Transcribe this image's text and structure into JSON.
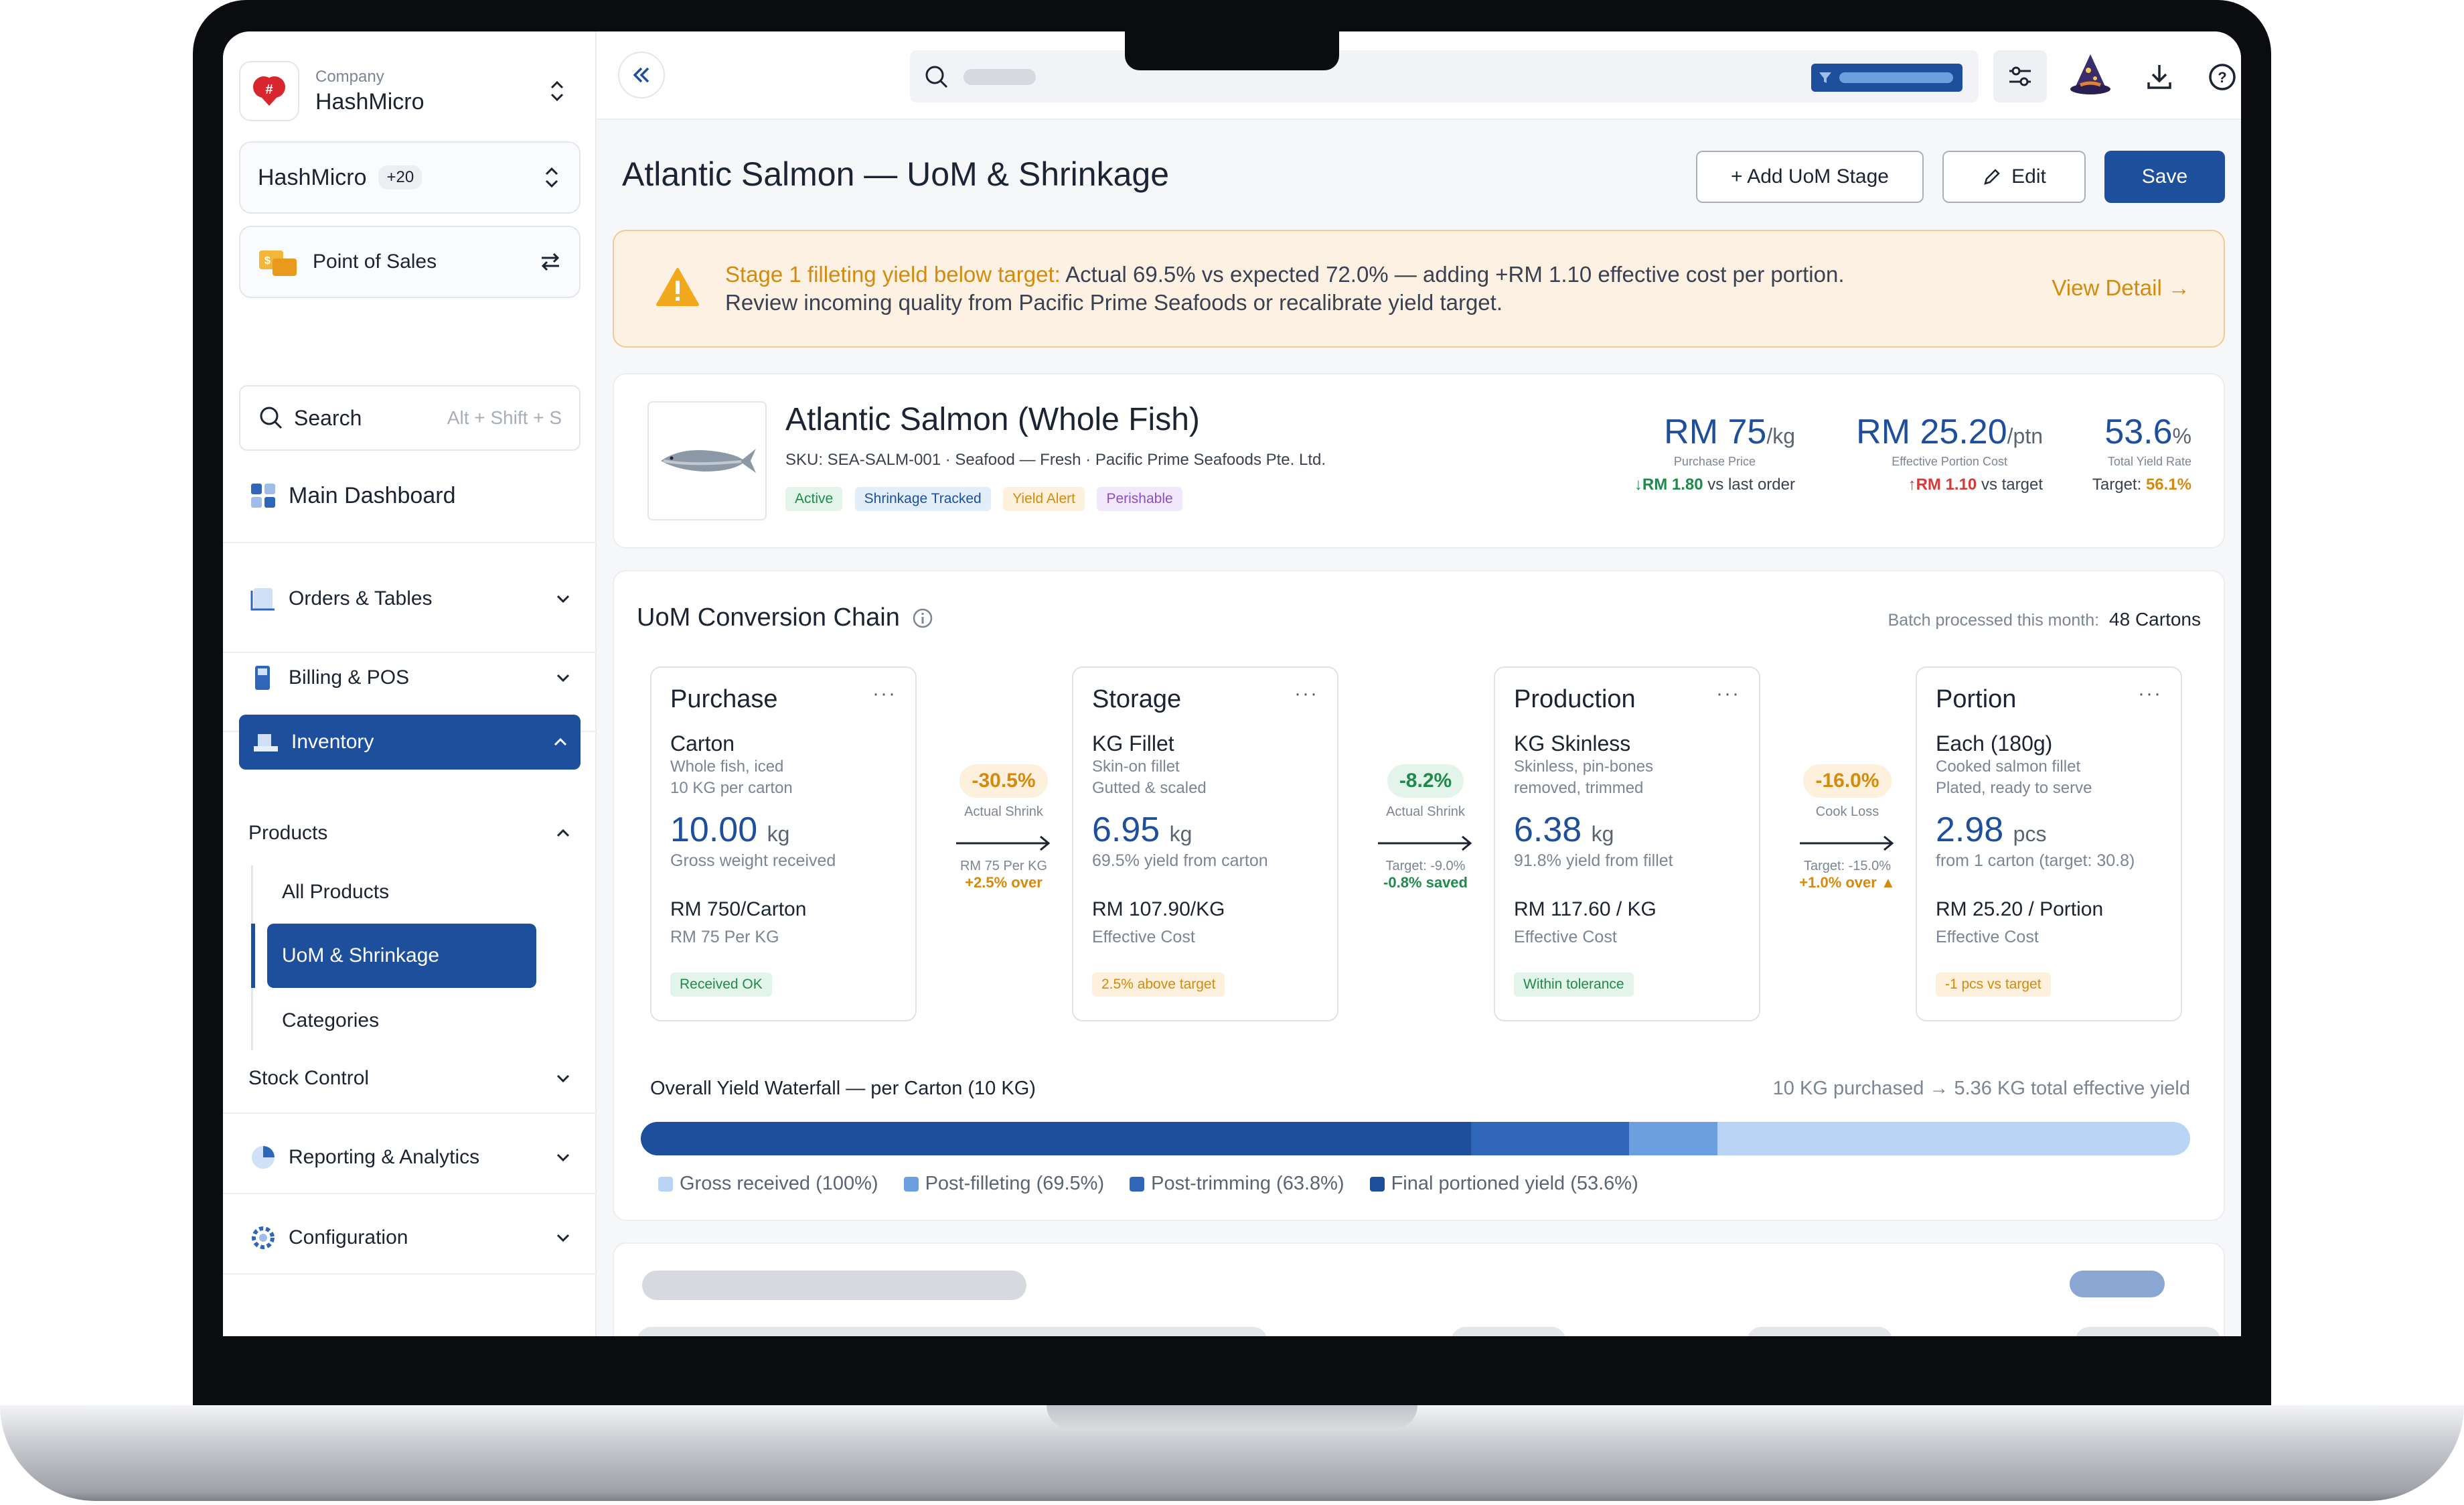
{
  "company": {
    "label": "Company",
    "name": "HashMicro"
  },
  "org": {
    "name": "HashMicro",
    "count": "+20"
  },
  "module": {
    "name": "Point of Sales"
  },
  "search": {
    "placeholder": "Search",
    "shortcut": "Alt + Shift + S"
  },
  "nav": {
    "main_dashboard": "Main Dashboard",
    "orders_tables": "Orders & Tables",
    "billing_pos": "Billing & POS",
    "inventory": "Inventory",
    "products": "Products",
    "all_products": "All Products",
    "uom_shrinkage": "UoM & Shrinkage",
    "categories": "Categories",
    "stock_control": "Stock Control",
    "reporting": "Reporting & Analytics",
    "configuration": "Configuration"
  },
  "page": {
    "title": "Atlantic Salmon — UoM & Shrinkage"
  },
  "actions": {
    "add_stage": "+ Add UoM Stage",
    "edit": "Edit",
    "save": "Save"
  },
  "alert": {
    "title": "Stage 1 filleting yield below target:",
    "line1": "Actual 69.5% vs expected 72.0% — adding +RM 1.10 effective cost per portion.",
    "line2": "Review incoming quality from Pacific Prime Seafoods or recalibrate yield target.",
    "link": "View Detail →"
  },
  "product": {
    "name": "Atlantic Salmon (Whole Fish)",
    "meta": "SKU: SEA-SALM-001 · Seafood — Fresh · Pacific Prime Seafoods Pte. Ltd.",
    "tags": [
      "Active",
      "Shrinkage Tracked",
      "Yield Alert",
      "Perishable"
    ],
    "kpi1": {
      "value": "RM 75",
      "unit": "/kg",
      "label": "Purchase Price",
      "delta": "↓RM 1.80",
      "delta_note": " vs last order"
    },
    "kpi2": {
      "value": "RM 25.20",
      "unit": "/ptn",
      "label": "Effective Portion Cost",
      "delta": "↑RM 1.10",
      "delta_note": " vs target"
    },
    "kpi3": {
      "value": "53.6",
      "unit": "%",
      "label": "Total Yield Rate",
      "target_label": "Target: ",
      "target": "56.1%"
    }
  },
  "chain": {
    "title": "UoM Conversion Chain",
    "batch_label": "Batch processed this month:",
    "batch_value": "48 Cartons",
    "stages": [
      {
        "title": "Purchase",
        "unit": "Carton",
        "desc1": "Whole fish, iced",
        "desc2": "10 KG per carton",
        "qty": "10.00",
        "qty_unit": "kg",
        "qty_note": "Gross weight received",
        "price": "RM 750/Carton",
        "price_note": "RM 75 Per KG",
        "badge": "Received OK"
      },
      {
        "title": "Storage",
        "unit": "KG Fillet",
        "desc1": "Skin-on fillet",
        "desc2": "Gutted & scaled",
        "qty": "6.95",
        "qty_unit": "kg",
        "qty_note": "69.5% yield from carton",
        "price": "RM 107.90/KG",
        "price_note": "Effective Cost",
        "badge": "2.5% above target"
      },
      {
        "title": "Production",
        "unit": "KG Skinless",
        "desc1": "Skinless, pin-bones",
        "desc2": "removed, trimmed",
        "qty": "6.38",
        "qty_unit": "kg",
        "qty_note": "91.8% yield from fillet",
        "price": "RM 117.60 / KG",
        "price_note": "Effective Cost",
        "badge": "Within tolerance"
      },
      {
        "title": "Portion",
        "unit": "Each (180g)",
        "desc1": "Cooked salmon fillet",
        "desc2": "Plated, ready to serve",
        "qty": "2.98",
        "qty_unit": "pcs",
        "qty_note": "from 1 carton (target: 30.8)",
        "price": "RM 25.20 / Portion",
        "price_note": "Effective Cost",
        "badge": "-1 pcs vs target"
      }
    ],
    "connectors": [
      {
        "pct": "-30.5%",
        "label": "Actual Shrink",
        "note1": "RM 75 Per KG",
        "note2": "+2.5% over"
      },
      {
        "pct": "-8.2%",
        "label": "Actual Shrink",
        "note1": "Target: -9.0%",
        "note2": "-0.8% saved"
      },
      {
        "pct": "-16.0%",
        "label": "Cook Loss",
        "note1": "Target: -15.0%",
        "note2": "+1.0% over ▲"
      }
    ],
    "waterfall": {
      "title": "Overall Yield Waterfall — per Carton (10 KG)",
      "summary": "10 KG purchased → 5.36 KG total effective yield",
      "segments": [
        {
          "label": "Gross received (100%)",
          "pct": 100,
          "color": "#b9d4f5"
        },
        {
          "label": "Post-filleting (69.5%)",
          "pct": 69.5,
          "color": "#6c9fe0"
        },
        {
          "label": "Post-trimming (63.8%)",
          "pct": 63.8,
          "color": "#2f66b8"
        },
        {
          "label": "Final portioned yield (53.6%)",
          "pct": 53.6,
          "color": "#1e4f9c"
        }
      ]
    }
  },
  "colors": {
    "primary": "#1e4f9c",
    "warning": "#d48a0c",
    "danger": "#d93838",
    "success": "#1f8a4c"
  }
}
